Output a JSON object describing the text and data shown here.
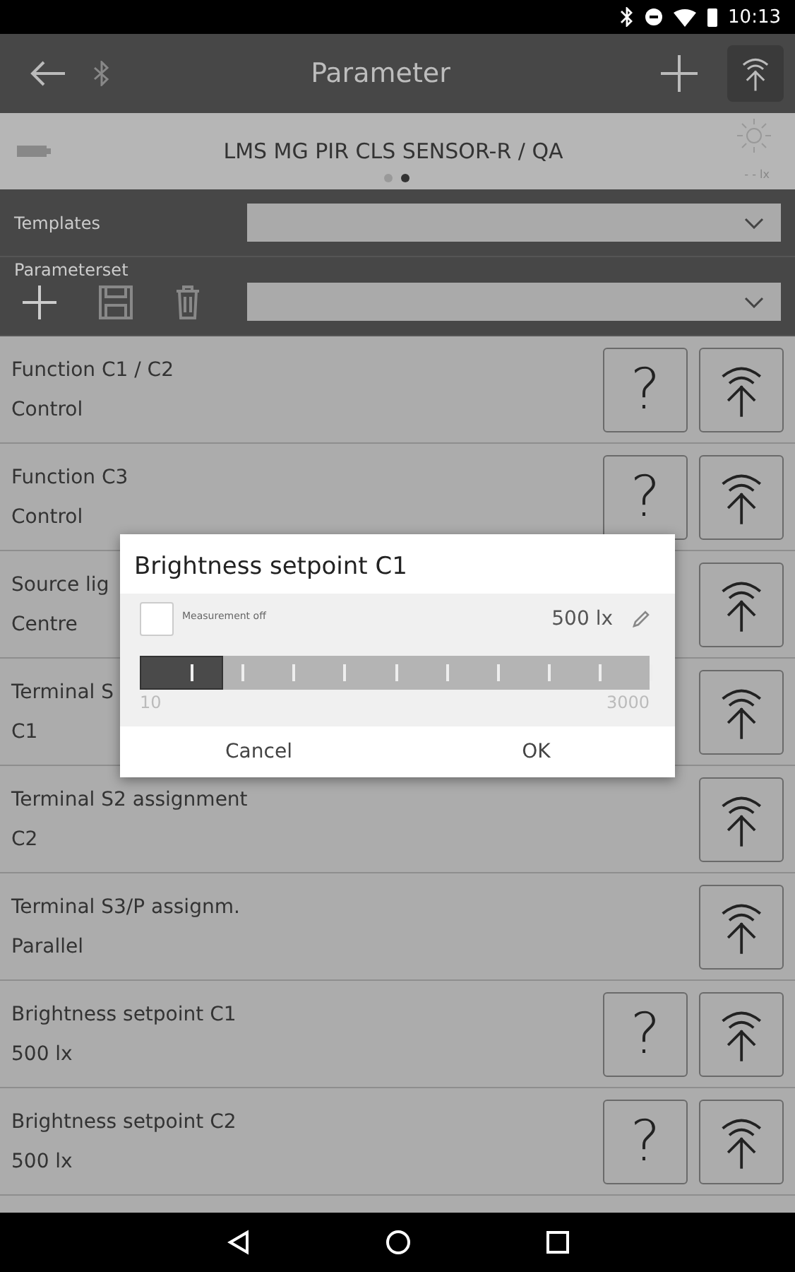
{
  "status_bar": {
    "time": "10:13"
  },
  "toolbar": {
    "title": "Parameter"
  },
  "device": {
    "name": "LMS MG PIR CLS SENSOR-R / QA",
    "pages": [
      {
        "selected": false
      },
      {
        "selected": true
      }
    ],
    "lux": "- - lx"
  },
  "templates": {
    "label": "Templates"
  },
  "parameterset": {
    "label": "Parameterset"
  },
  "parameters": [
    {
      "name": "Function C1 / C2",
      "value": "Control",
      "help": "?"
    },
    {
      "name": "Function C3",
      "value": "Control",
      "help": "?"
    },
    {
      "name": "Source lig",
      "value": "Centre"
    },
    {
      "name": "Terminal S",
      "value": "C1"
    },
    {
      "name": "Terminal S2 assignment",
      "value": "C2"
    },
    {
      "name": "Terminal S3/P assignm.",
      "value": "Parallel"
    },
    {
      "name": "Brightness setpoint C1",
      "value": "500 lx",
      "help": "?"
    },
    {
      "name": "Brightness setpoint C2",
      "value": "500 lx",
      "help": "?"
    }
  ],
  "dialog": {
    "title": "Brightness setpoint C1",
    "checkbox": {
      "label": "Measurement off",
      "checked": false
    },
    "reading": "500 lx",
    "slider": {
      "level": 0.163,
      "min": "10",
      "max": "3000"
    },
    "buttons": [
      "Cancel",
      "OK"
    ]
  }
}
